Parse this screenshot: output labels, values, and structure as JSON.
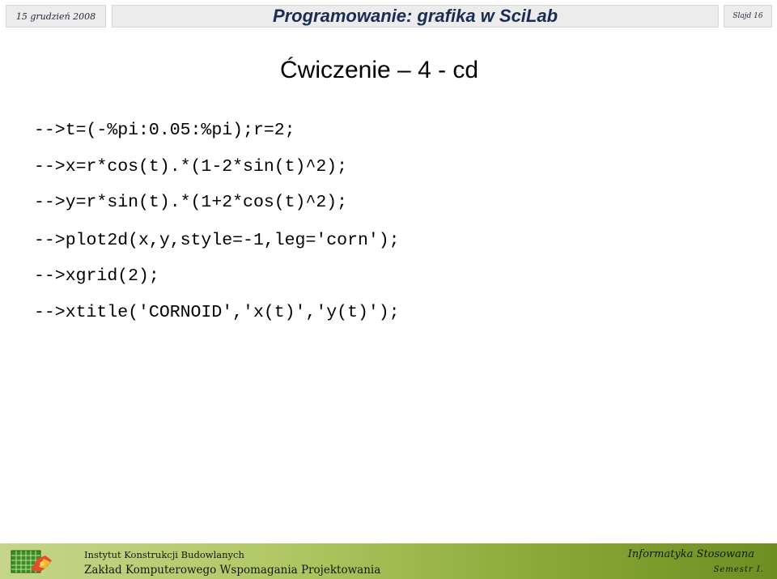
{
  "header": {
    "date": "15 grudzień 2008",
    "title": "Programowanie: grafika w SciLab",
    "slide_number": "Slajd 16"
  },
  "slide": {
    "heading": "Ćwiczenie – 4 - cd",
    "code_lines": [
      "-->t=(-%pi:0.05:%pi);r=2;",
      "-->x=r*cos(t).*(1-2*sin(t)^2);",
      "-->y=r*sin(t).*(1+2*cos(t)^2);",
      "-->plot2d(x,y,style=-1,leg='corn');",
      "-->xgrid(2);",
      "-->xtitle('CORNOID','x(t)','y(t)');"
    ]
  },
  "footer": {
    "institute": "Instytut Konstrukcji Budowlanych",
    "department": "Zakład Komputerowego Wspomagania Projektowania",
    "course": "Informatyka Stosowana",
    "semester": "Semestr I.",
    "logo_icon": "grid-logo-icon"
  }
}
